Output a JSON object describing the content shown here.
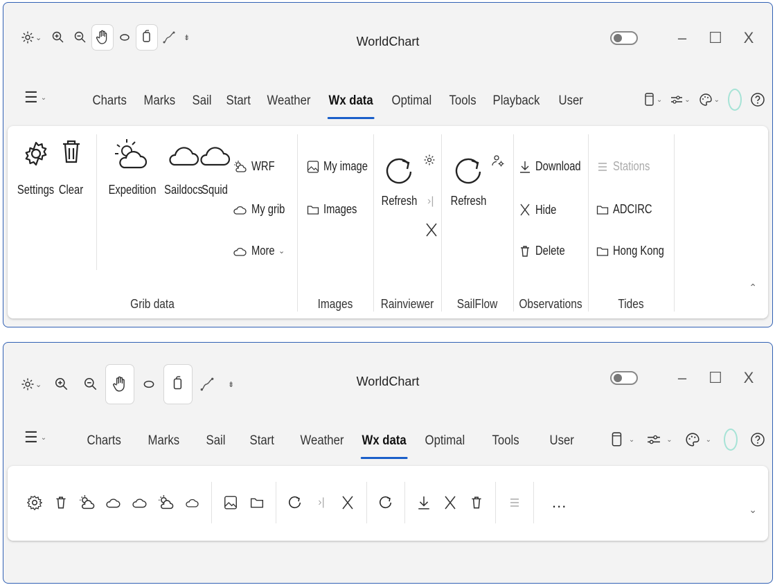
{
  "app": {
    "title": "WorldChart"
  },
  "window_controls": {
    "minimize": "–",
    "maximize": "☐",
    "close": "X"
  },
  "menu": {
    "tabs": [
      {
        "label": "Charts"
      },
      {
        "label": "Marks"
      },
      {
        "label": "Sail"
      },
      {
        "label": "Start"
      },
      {
        "label": "Weather"
      },
      {
        "label": "Wx data"
      },
      {
        "label": "Optimal"
      },
      {
        "label": "Tools"
      },
      {
        "label": "Playback"
      },
      {
        "label": "User"
      }
    ],
    "tabs_compact": [
      {
        "label": "Charts"
      },
      {
        "label": "Marks"
      },
      {
        "label": "Sail"
      },
      {
        "label": "Start"
      },
      {
        "label": "Weather"
      },
      {
        "label": "Wx data"
      },
      {
        "label": "Optimal"
      },
      {
        "label": "Tools"
      },
      {
        "label": "User"
      }
    ],
    "active_tab": "Wx data"
  },
  "ribbon": {
    "grib": {
      "label": "Grib data",
      "settings": "Settings",
      "clear": "Clear",
      "expedition": "Expedition",
      "saildocs": "Saildocs",
      "squid": "Squid",
      "wrf": "WRF",
      "mygrib": "My grib",
      "more": "More"
    },
    "images": {
      "label": "Images",
      "myimage": "My image",
      "images": "Images"
    },
    "rainviewer": {
      "label": "Rainviewer",
      "refresh": "Refresh"
    },
    "sailflow": {
      "label": "SailFlow",
      "refresh": "Refresh"
    },
    "observations": {
      "label": "Observations",
      "download": "Download",
      "hide": "Hide",
      "delete": "Delete"
    },
    "tides": {
      "label": "Tides",
      "stations": "Stations",
      "adcirc": "ADCIRC",
      "hongkong": "Hong Kong"
    }
  },
  "compact": {
    "more": "..."
  },
  "colors": {
    "accent": "#1a5fc9",
    "window_border": "#2f5fb3",
    "spinner": "#a6e3d6"
  },
  "icons": [
    "gear-icon",
    "zoom-in-icon",
    "zoom-out-icon",
    "hand-icon",
    "lasso-icon",
    "copy-icon",
    "route-icon",
    "trash-icon",
    "sun-cloud-icon",
    "cloud-icon",
    "image-icon",
    "folder-icon",
    "refresh-icon",
    "download-icon",
    "close-icon",
    "list-icon",
    "help-icon",
    "palette-icon",
    "sliders-icon",
    "phone-icon"
  ]
}
